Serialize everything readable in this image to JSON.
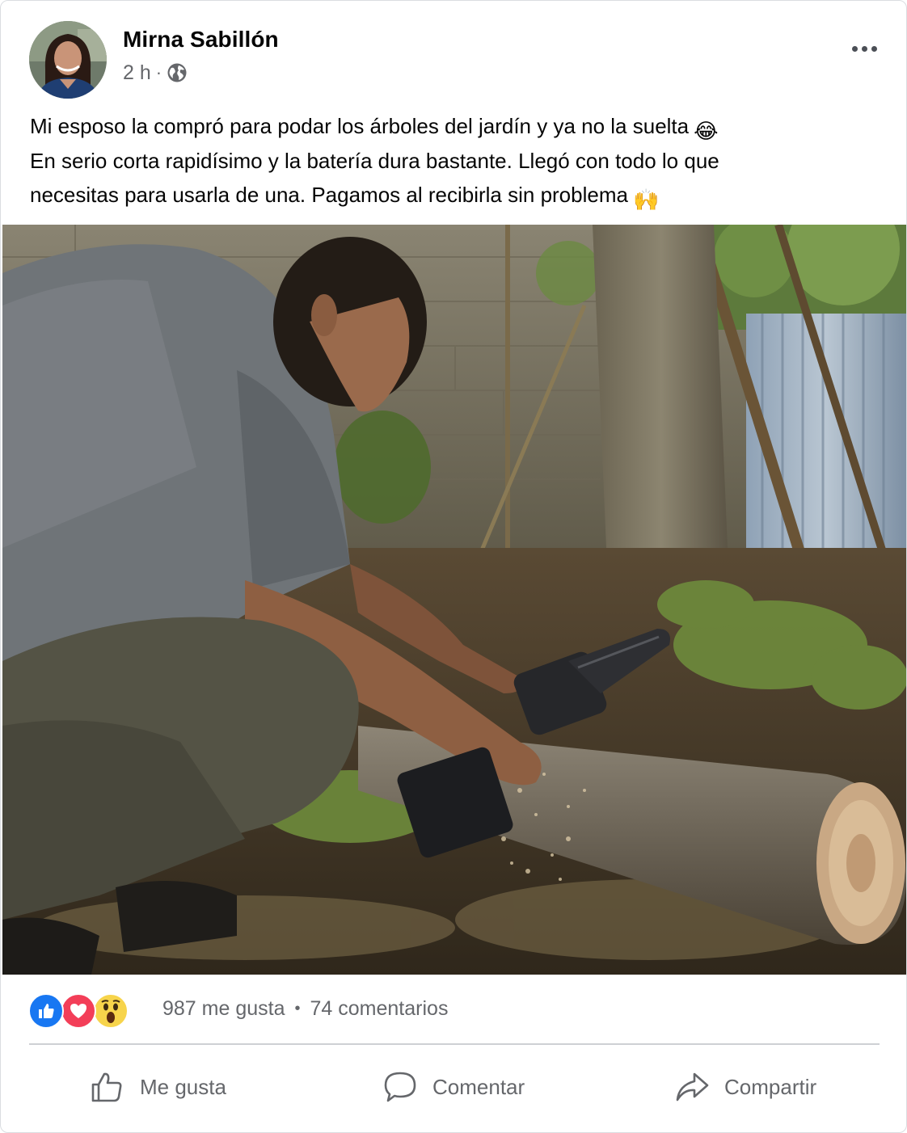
{
  "post": {
    "author": "Mirna Sabillón",
    "time": "2 h",
    "meta_separator": "·",
    "audience_icon": "globe-icon",
    "more_icon": "more-options-icon",
    "text_lines": [
      "Mi esposo la compró para podar los árboles del jardín y ya no la suelta",
      "En serio corta rapidísimo y la batería dura bastante. Llegó con todo lo que",
      "necesitas para usarla de una. Pagamos al recibirla sin problema"
    ],
    "line1_emoji": "😂",
    "line3_emoji": "🙌"
  },
  "engagement": {
    "reaction_icons": [
      "like-reaction-icon",
      "love-reaction-icon",
      "wow-reaction-icon"
    ],
    "likes": "987 me gusta",
    "separator": "•",
    "comments": "74 comentarios"
  },
  "actions": {
    "like_label": "Me gusta",
    "comment_label": "Comentar",
    "share_label": "Compartir"
  },
  "colors": {
    "like_blue": "#1877f2",
    "love_red": "#f33e58",
    "wow_yellow": "#f7d44b",
    "secondary_text": "#65676b"
  }
}
